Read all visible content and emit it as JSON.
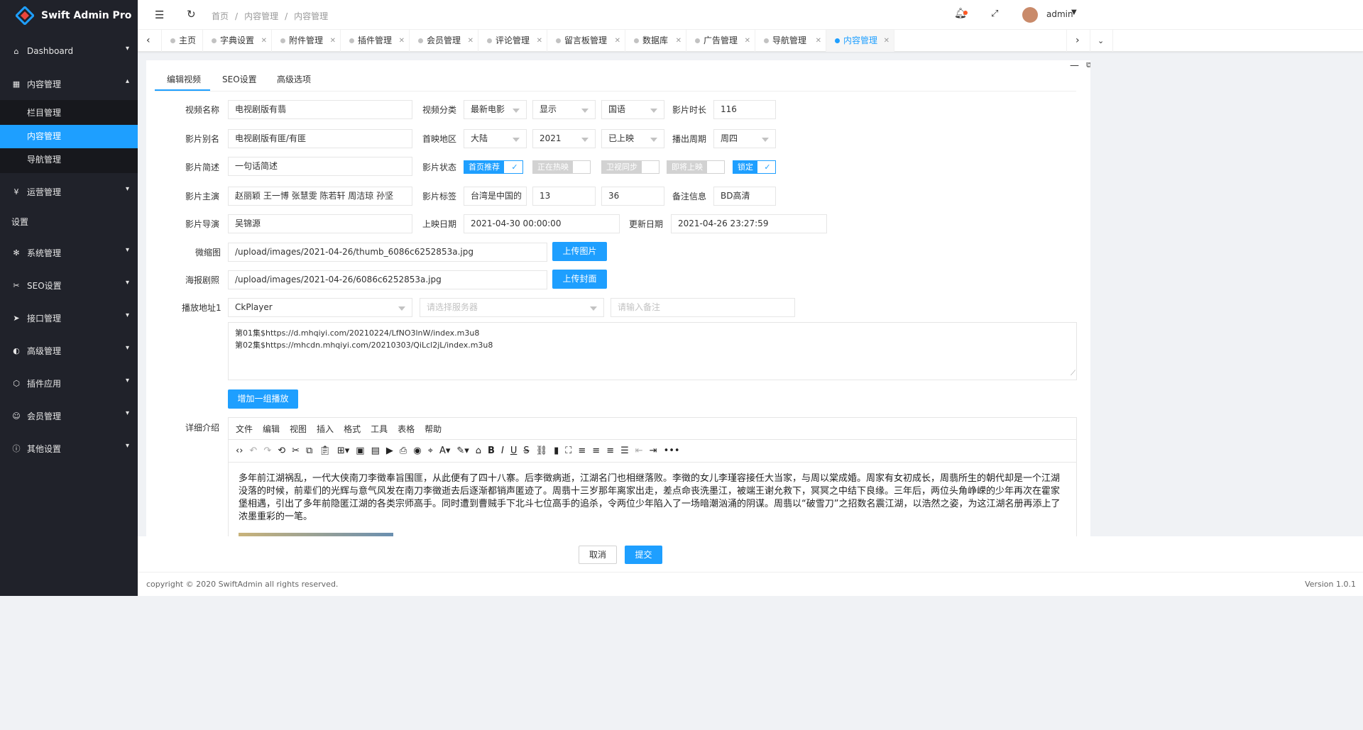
{
  "app": {
    "title": "Swift Admin Pro"
  },
  "sidebar": {
    "items": [
      {
        "label": "Dashboard",
        "icon": "home-icon"
      },
      {
        "label": "内容管理",
        "icon": "grid-icon"
      }
    ],
    "sub": [
      "栏目管理",
      "内容管理",
      "导航管理"
    ],
    "items2": [
      {
        "label": "运营管理",
        "icon": "yen-icon"
      }
    ],
    "group": "设置",
    "items3": [
      {
        "label": "系统管理",
        "icon": "gear-icon"
      },
      {
        "label": "SEO设置",
        "icon": "tools-icon"
      },
      {
        "label": "接口管理",
        "icon": "send-icon"
      },
      {
        "label": "高级管理",
        "icon": "advanced-icon"
      },
      {
        "label": "插件应用",
        "icon": "plugin-icon"
      },
      {
        "label": "会员管理",
        "icon": "user-icon"
      },
      {
        "label": "其他设置",
        "icon": "info-icon"
      }
    ]
  },
  "header": {
    "breadcrumb": [
      "首页",
      "内容管理",
      "内容管理"
    ],
    "user": "admin"
  },
  "tabs": [
    "主页",
    "字典设置",
    "附件管理",
    "插件管理",
    "会员管理",
    "评论管理",
    "留言板管理",
    "数据库",
    "广告管理",
    "导航管理",
    "内容管理"
  ],
  "form": {
    "tabs": [
      "编辑视频",
      "SEO设置",
      "高级选项"
    ],
    "labels": {
      "name": "视频名称",
      "category": "视频分类",
      "duration": "影片时长",
      "alias": "影片别名",
      "region": "首映地区",
      "cycle": "播出周期",
      "brief": "影片简述",
      "status": "影片状态",
      "actors": "影片主演",
      "tags": "影片标签",
      "remark": "备注信息",
      "director": "影片导演",
      "release": "上映日期",
      "update": "更新日期",
      "thumb": "微缩图",
      "poster": "海报剧照",
      "play": "播放地址1",
      "detail": "详细介绍"
    },
    "values": {
      "name": "电视剧版有翡",
      "category": "最新电影",
      "display": "显示",
      "language": "国语",
      "duration": "116",
      "alias": "电视剧版有匪/有匪",
      "region": "大陆",
      "year": "2021",
      "released": "已上映",
      "cycle": "周四",
      "brief": "一句话简述",
      "actors": "赵丽颖 王一博 张慧雯 陈若轩 周洁琼 孙坚",
      "tag1": "台湾是中国的",
      "tag2": "13",
      "tag3": "36",
      "remark": "BD高清",
      "director": "吴锦源",
      "release": "2021-04-30 00:00:00",
      "update": "2021-04-26 23:27:59",
      "thumb": "/upload/images/2021-04-26/thumb_6086c6252853a.jpg",
      "poster": "/upload/images/2021-04-26/6086c6252853a.jpg",
      "player": "CkPlayer",
      "server_ph": "请选择服务器",
      "note_ph": "请输入备注",
      "urls": [
        "第01集$https://d.mhqiyi.com/20210224/LfNO3lnW/index.m3u8",
        "第02集$https://mhcdn.mhqiyi.com/20210303/QiLcl2jL/index.m3u8"
      ]
    },
    "switches": [
      "首页推荐",
      "正在热映",
      "卫视同步",
      "即将上映",
      "锁定"
    ],
    "buttons": {
      "upload_img": "上传图片",
      "upload_cover": "上传封面",
      "add_play": "增加一组播放",
      "cancel": "取消",
      "submit": "提交"
    },
    "editor": {
      "menu": [
        "文件",
        "编辑",
        "视图",
        "插入",
        "格式",
        "工具",
        "表格",
        "帮助"
      ],
      "text": "多年前江湖祸乱，一代大侠南刀李徵奉旨围匪，从此便有了四十八寨。后李徵病逝，江湖名门也相继落败。李徵的女儿李瑾容接任大当家，与周以棠成婚。周家有女初成长，周翡所生的朝代却是一个江湖没落的时候，前辈们的光辉与意气风发在南刀李徵逝去后逐渐都销声匿迹了。周翡十三岁那年离家出走，差点命丧洗墨江，被端王谢允救下，冥冥之中结下良缘。三年后，两位头角峥嵘的少年再次在霍家堡相遇，引出了多年前隐匿江湖的各类宗师高手。同时遭到曹贼手下北斗七位高手的追杀，令两位少年陷入了一场暗潮汹涌的阴谋。周翡以“破雪刀”之招数名震江湖，以浩然之姿，为这江湖名册再添上了浓墨重彩的一笔。"
    }
  },
  "footer": {
    "copyright": "copyright © 2020 SwiftAdmin all rights reserved.",
    "version": "Version 1.0.1"
  },
  "colors": {
    "accent": "#1e9fff",
    "sidebar": "#20222a"
  }
}
